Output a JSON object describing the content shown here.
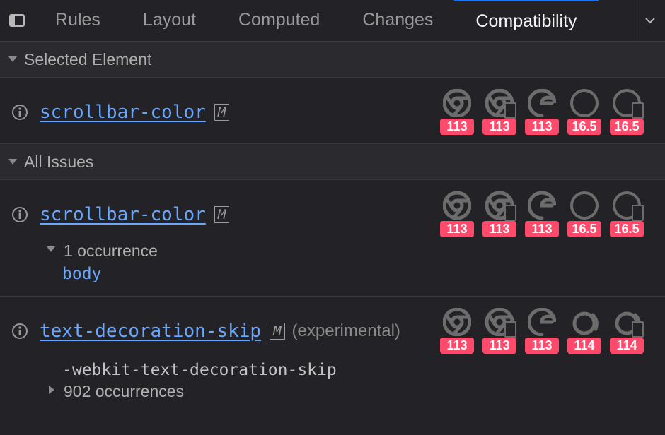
{
  "tabs": {
    "rules": "Rules",
    "layout": "Layout",
    "computed": "Computed",
    "changes": "Changes",
    "compat": "Compatibility"
  },
  "sections": {
    "selected": "Selected Element",
    "all": "All Issues"
  },
  "issue1": {
    "prop": "scrollbar-color",
    "mdn": "M",
    "browsers": [
      {
        "name": "chrome",
        "ver": "113"
      },
      {
        "name": "chrome-mobile",
        "ver": "113"
      },
      {
        "name": "edge",
        "ver": "113"
      },
      {
        "name": "safari",
        "ver": "16.5"
      },
      {
        "name": "safari-mobile",
        "ver": "16.5"
      }
    ]
  },
  "issue2": {
    "prop": "scrollbar-color",
    "mdn": "M",
    "occ": "1 occurrence",
    "selector": "body",
    "browsers": [
      {
        "name": "chrome",
        "ver": "113"
      },
      {
        "name": "chrome-mobile",
        "ver": "113"
      },
      {
        "name": "edge",
        "ver": "113"
      },
      {
        "name": "safari",
        "ver": "16.5"
      },
      {
        "name": "safari-mobile",
        "ver": "16.5"
      }
    ]
  },
  "issue3": {
    "prop": "text-decoration-skip",
    "mdn": "M",
    "tag": "(experimental)",
    "alias": "-webkit-text-decoration-skip",
    "occ": "902 occurrences",
    "browsers": [
      {
        "name": "chrome",
        "ver": "113"
      },
      {
        "name": "chrome-mobile",
        "ver": "113"
      },
      {
        "name": "edge",
        "ver": "113"
      },
      {
        "name": "firefox",
        "ver": "114"
      },
      {
        "name": "firefox-mobile",
        "ver": "114"
      }
    ]
  }
}
